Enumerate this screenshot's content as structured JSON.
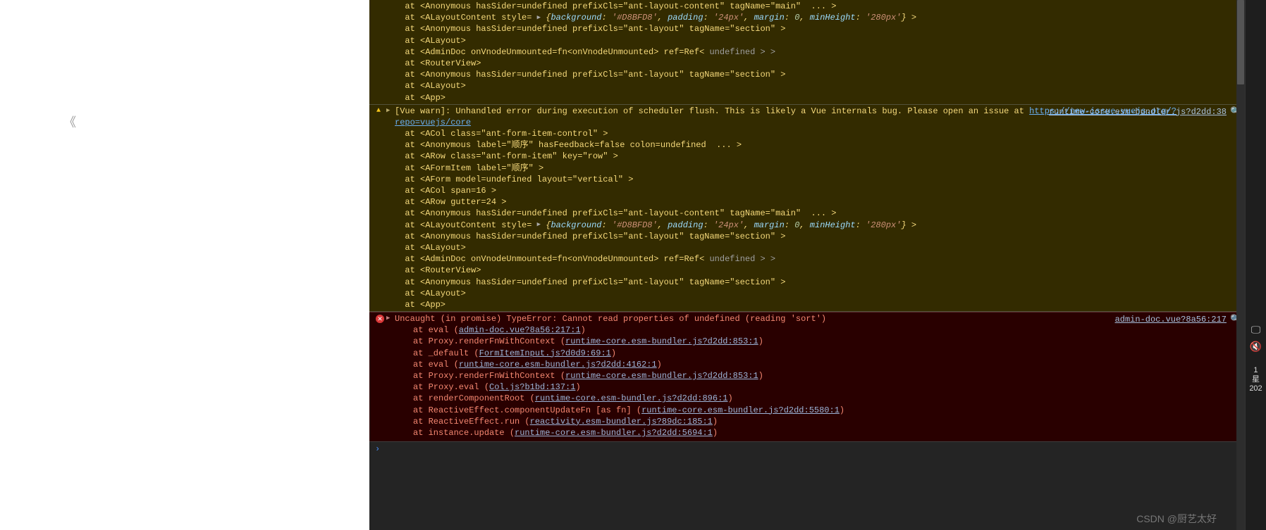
{
  "leftPane": {
    "chevronGlyph": "《"
  },
  "warn0": {
    "lines": [
      "  at <Anonymous hasSider=undefined prefixCls=\"ant-layout-content\" tagName=\"main\"  ... >",
      "  at <ALayoutContent style=",
      "  at <Anonymous hasSider=undefined prefixCls=\"ant-layout\" tagName=\"section\" >",
      "  at <ALayout>",
      "  at <AdminDoc onVnodeUnmounted=fn<onVnodeUnmounted> ref=Ref<",
      "  at <RouterView>",
      "  at <Anonymous hasSider=undefined prefixCls=\"ant-layout\" tagName=\"section\" >",
      "  at <ALayout>",
      "  at <App>"
    ],
    "styleObj": {
      "background": "'#D8BFD8'",
      "padding": "'24px'",
      "margin": "0",
      "minHeight": "'280px'"
    },
    "undefSuffix": " undefined > >"
  },
  "warn1": {
    "headerText": "[Vue warn]: Unhandled error during execution of scheduler flush. This is likely a Vue internals bug. Please open an issue at ",
    "issueUrl": "https://new-issue.vuejs.org/?repo=vuejs/core",
    "sourceLink": "runtime-core.esm-bundler.js?d2dd:38",
    "stack": [
      "  at <ACol class=\"ant-form-item-control\" >",
      "  at <Anonymous label=\"顺序\" hasFeedback=false colon=undefined  ... >",
      "  at <ARow class=\"ant-form-item\" key=\"row\" >",
      "  at <AFormItem label=\"顺序\" >",
      "  at <AForm model=undefined layout=\"vertical\" >",
      "  at <ACol span=16 >",
      "  at <ARow gutter=24 >",
      "  at <Anonymous hasSider=undefined prefixCls=\"ant-layout-content\" tagName=\"main\"  ... >",
      "  at <ALayoutContent style=",
      "  at <Anonymous hasSider=undefined prefixCls=\"ant-layout\" tagName=\"section\" >",
      "  at <ALayout>",
      "  at <AdminDoc onVnodeUnmounted=fn<onVnodeUnmounted> ref=Ref<",
      "  at <RouterView>",
      "  at <Anonymous hasSider=undefined prefixCls=\"ant-layout\" tagName=\"section\" >",
      "  at <ALayout>",
      "  at <App>"
    ],
    "styleObj": {
      "background": "'#D8BFD8'",
      "padding": "'24px'",
      "margin": "0",
      "minHeight": "'280px'"
    },
    "undefSuffix": " undefined > >"
  },
  "error": {
    "sourceLink": "admin-doc.vue?8a56:217",
    "header": "Uncaught (in promise) TypeError: Cannot read properties of undefined (reading 'sort')",
    "lines": [
      {
        "pre": "at eval (",
        "link": "admin-doc.vue?8a56:217:1",
        "post": ")"
      },
      {
        "pre": "at Proxy.renderFnWithContext (",
        "link": "runtime-core.esm-bundler.js?d2dd:853:1",
        "post": ")"
      },
      {
        "pre": "at _default (",
        "link": "FormItemInput.js?d0d9:69:1",
        "post": ")"
      },
      {
        "pre": "at eval (",
        "link": "runtime-core.esm-bundler.js?d2dd:4162:1",
        "post": ")"
      },
      {
        "pre": "at Proxy.renderFnWithContext (",
        "link": "runtime-core.esm-bundler.js?d2dd:853:1",
        "post": ")"
      },
      {
        "pre": "at Proxy.eval (",
        "link": "Col.js?b1bd:137:1",
        "post": ")"
      },
      {
        "pre": "at renderComponentRoot (",
        "link": "runtime-core.esm-bundler.js?d2dd:896:1",
        "post": ")"
      },
      {
        "pre": "at ReactiveEffect.componentUpdateFn [as fn] (",
        "link": "runtime-core.esm-bundler.js?d2dd:5580:1",
        "post": ")"
      },
      {
        "pre": "at ReactiveEffect.run (",
        "link": "reactivity.esm-bundler.js?89dc:185:1",
        "post": ")"
      },
      {
        "pre": "at instance.update (",
        "link": "runtime-core.esm-bundler.js?d2dd:5694:1",
        "post": ")"
      }
    ]
  },
  "prompt": {
    "glyph": "›"
  },
  "watermark": "CSDN @厨艺太好",
  "rightStrip": {
    "time1": "1",
    "time2": "星",
    "time3": "202"
  }
}
